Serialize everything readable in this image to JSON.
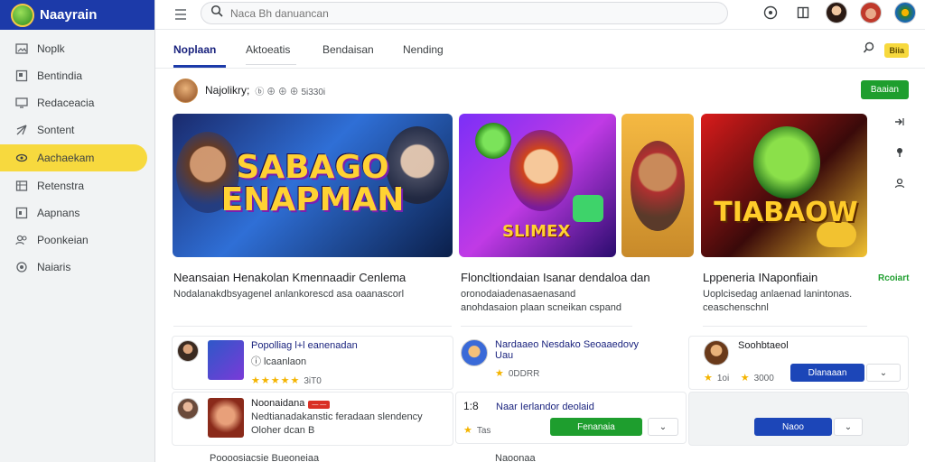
{
  "app": {
    "name": "Naayrain"
  },
  "sidebar": {
    "items": [
      {
        "label": "Noplk",
        "icon": "image-icon"
      },
      {
        "label": "Bentindia",
        "icon": "frame-icon"
      },
      {
        "label": "Redaceacia",
        "icon": "monitor-icon"
      },
      {
        "label": "Sontent",
        "icon": "send-icon"
      },
      {
        "label": "Aachaekam",
        "icon": "link-icon",
        "active": true
      },
      {
        "label": "Retenstra",
        "icon": "grid-icon"
      },
      {
        "label": "Aapnans",
        "icon": "tile-icon"
      },
      {
        "label": "Poonkeian",
        "icon": "people-icon"
      },
      {
        "label": "Naiaris",
        "icon": "target-icon"
      }
    ]
  },
  "search": {
    "placeholder": "Naca Bh danuancan"
  },
  "tabs": [
    {
      "label": "Noplaan",
      "active": true
    },
    {
      "label": "Aktoeatis"
    },
    {
      "label": "Bendaisan"
    },
    {
      "label": "Nending"
    }
  ],
  "tabs_right": {
    "badge": "Biia"
  },
  "channel": {
    "name": "Najolikry;",
    "meta": "ⓑ ⊕ ⊕ ⊕ 5i330i",
    "button": "Baaian"
  },
  "featured": [
    {
      "thumb_text": "SABAGO ENAPMAN",
      "title": "Neansaian Henakolan Kmennaadir Cenlema",
      "desc": "Nodalanakdbsyagenel anlankorescd asa oaanascorl"
    },
    {
      "thumb_text": "SLIMEX",
      "title": "Floncltiondaian Isanar dendaloa dan",
      "desc": "oronodaiadenasaenasand anohdasaion plaan scneikan cspand"
    },
    {
      "thumb_text": "TIABAOW",
      "title": "Lppeneria INaponfiain",
      "desc": "Uoplcisedag anlaenad lanintonas. ceaschenschnl"
    }
  ],
  "featured_link": "Rcoiart",
  "list_left": [
    {
      "title": "Popolliag l+l eanenadan",
      "sub": "ⓘ lcaanlaon",
      "stars": "★★★★★",
      "rating": "3iT0"
    },
    {
      "title": "Noonaidana",
      "tag": "— —",
      "sub": "Nedtianadakanstic feradaan slendency",
      "sub2": "Oloher dcan B"
    }
  ],
  "list_mid": [
    {
      "title": "Nardaaeo Nesdako Seoaaedovy",
      "title2": "Uau",
      "stars": "★",
      "rating": "0DDRR"
    },
    {
      "count": "1:8",
      "title": "Naar Ierlandor deolaid",
      "stars": "★",
      "rating": "Tas",
      "button": "Fenanaia"
    }
  ],
  "list_right": [
    {
      "title": "Soohbtaeol",
      "rating_a": "1oi",
      "rating_b": "3000",
      "button": "Dlanaaan"
    },
    {
      "button": "Naoo"
    }
  ],
  "bottom": {
    "left": "Poooosiacsie Bueoneiaa",
    "right": "Naoonaa"
  },
  "colors": {
    "brand": "#1c3aa9",
    "accent_yellow": "#f7d93e",
    "green": "#1e9e2e",
    "blue_button": "#1c46b8"
  }
}
